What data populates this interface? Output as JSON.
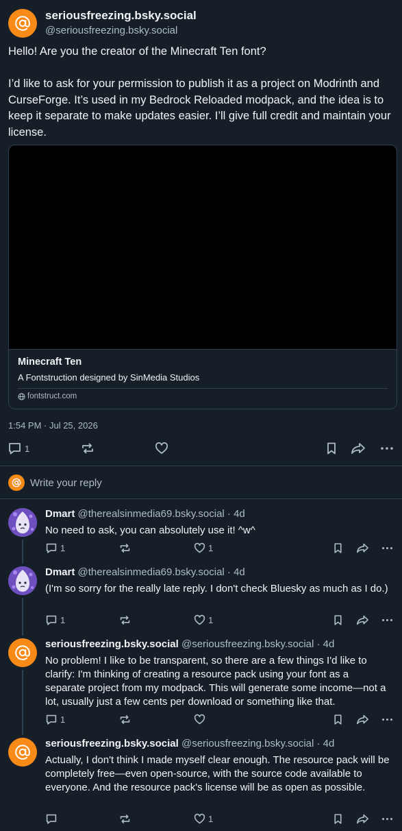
{
  "post": {
    "author_display": "seriousfreezing.bsky.social",
    "author_handle": "@seriousfreezing.bsky.social",
    "text": "Hello! Are you the creator of the Minecraft Ten font?\n\nI’d like to ask for your permission to publish it as a project on Modrinth and CurseForge. It’s used in my Bedrock Reloaded modpack, and the idea is to keep it separate to make updates easier. I’ll give full credit and maintain your license.",
    "link_card": {
      "title": "Minecraft Ten",
      "description": "A Fontstruction designed by SinMedia Studios",
      "domain": "fontstruct.com"
    },
    "timestamp": "1:54 PM · Jul 25, 2026",
    "reply_count": "1"
  },
  "reply_box": {
    "placeholder": "Write your reply"
  },
  "replies": [
    {
      "display": "Dmart",
      "handle": "@therealsinmedia69.bsky.social · 4d",
      "text": "No need to ask, you can absolutely use it! ^w^",
      "reply_count": "1",
      "like_count": "1"
    },
    {
      "display": "Dmart",
      "handle": "@therealsinmedia69.bsky.social · 4d",
      "text": "(I'm so sorry for the really late reply. I don't check Bluesky as much as I do.)",
      "reply_count": "1",
      "like_count": "1"
    },
    {
      "display": "seriousfreezing.bsky.social",
      "handle": "@seriousfreezing.bsky.social · 4d",
      "text": "No problem! I like to be transparent, so there are a few things I'd like to clarify: I'm thinking of creating a resource pack using your font as a separate project from my modpack. This will generate some income—not a lot, usually just a few cents per download or something like that.",
      "reply_count": "1",
      "like_count": ""
    },
    {
      "display": "seriousfreezing.bsky.social",
      "handle": "@seriousfreezing.bsky.social · 4d",
      "text": "Actually, I don't think I made myself clear enough. The resource pack will be completely free—even open-source, with the source code available to everyone. And the resource pack's license will be as open as possible.",
      "reply_count": "",
      "like_count": "1"
    }
  ],
  "colors": {
    "background": "#161e27",
    "border": "#2e4052",
    "text": "#f1f3f5",
    "muted": "#aebbc9",
    "avatar_orange": "#f88a17",
    "avatar_purple": "#7d5bc8"
  }
}
